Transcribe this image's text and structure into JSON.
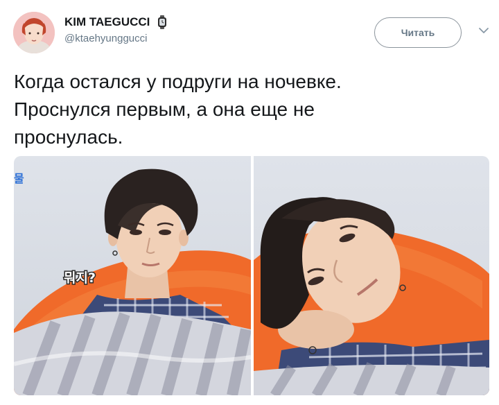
{
  "tweet": {
    "display_name": "KIM TAEGUCCI",
    "handle": "@ktaehyunggucci",
    "follow_label": "Читать",
    "text_lines": [
      "Когда остался у подруги на ночевке.",
      "Проснулся первым, а она еще не",
      "проснулась."
    ],
    "name_emoji_icon": "watch-icon",
    "menu_icon": "chevron-down-icon"
  },
  "media": {
    "left_photo_caption": "뭐지?",
    "left_photo_corner_mark": "물"
  }
}
